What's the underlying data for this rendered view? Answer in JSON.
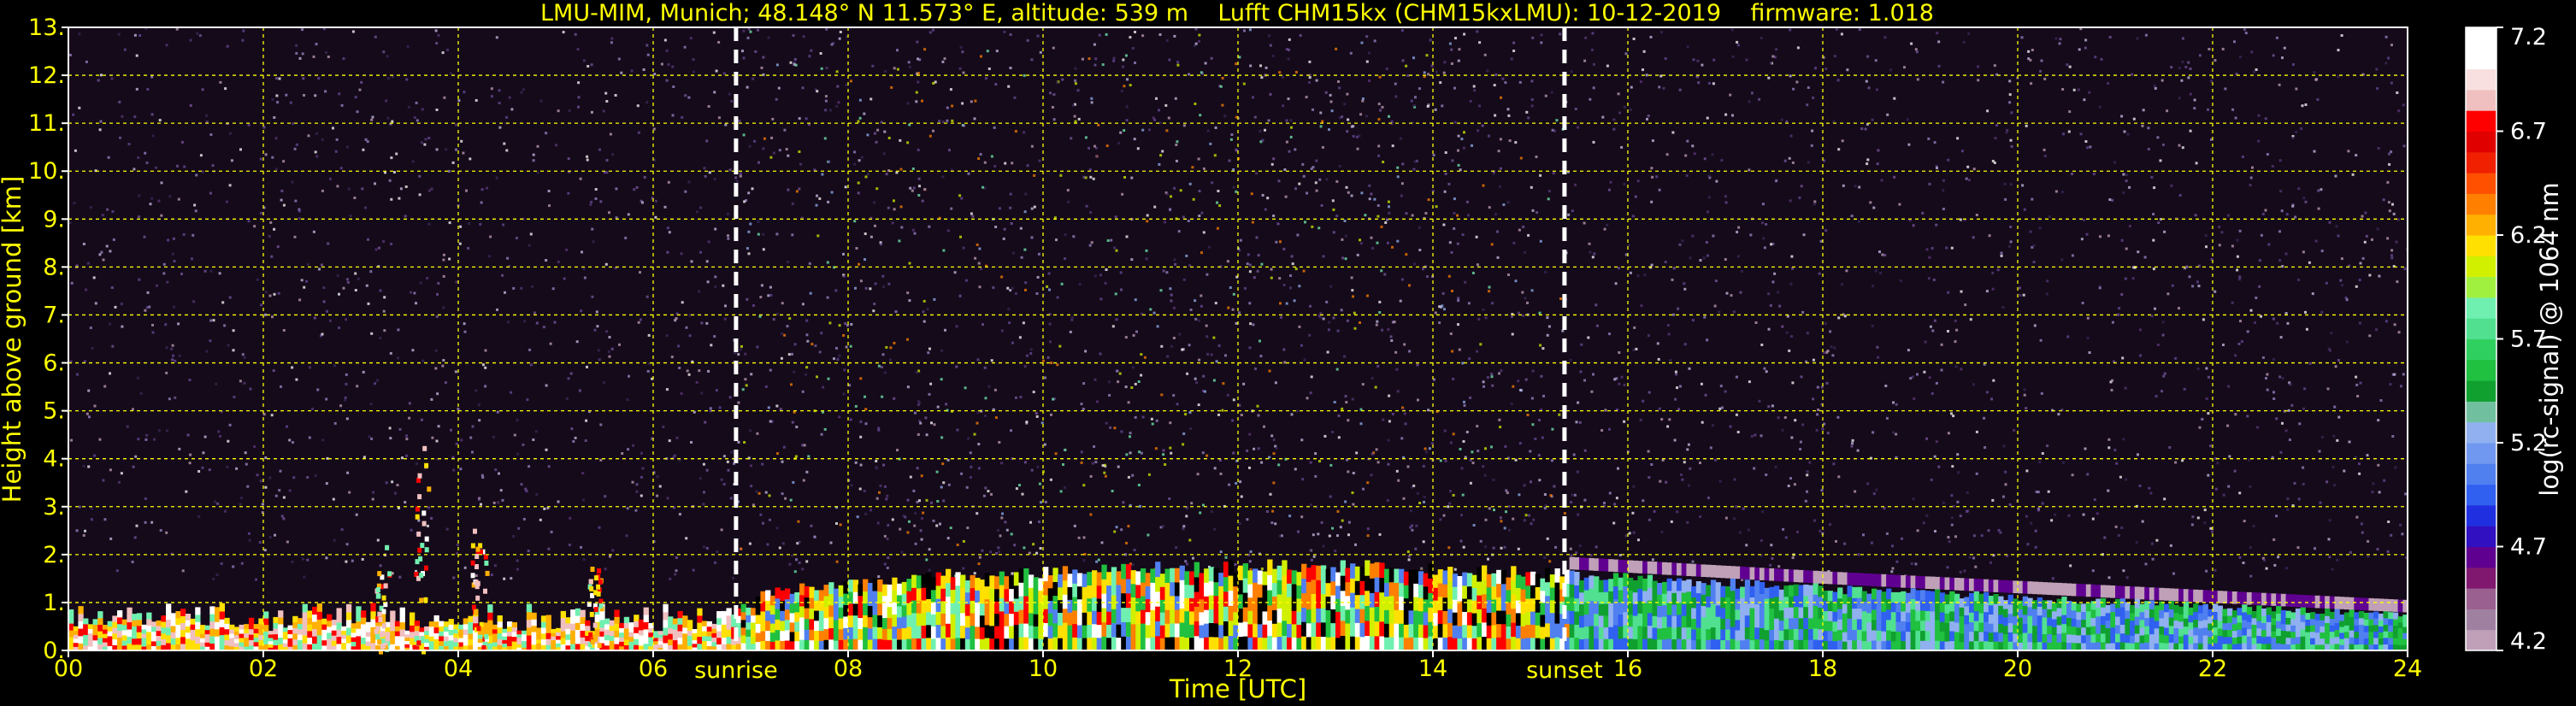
{
  "chart_data": {
    "type": "heatmap",
    "title": "LMU-MIM, Munich; 48.148° N 11.573° E, altitude: 539 m    Lufft CHM15kx (CHM15kxLMU): 10-12-2019    firmware: 1.018",
    "xlabel": "Time [UTC]",
    "ylabel": "Height above ground [km]",
    "xlim": [
      0,
      24
    ],
    "ylim": [
      0,
      13
    ],
    "x_ticks": [
      {
        "value": 0,
        "label": "00"
      },
      {
        "value": 2,
        "label": "02"
      },
      {
        "value": 4,
        "label": "04"
      },
      {
        "value": 6,
        "label": "06"
      },
      {
        "value": 8,
        "label": "08"
      },
      {
        "value": 10,
        "label": "10"
      },
      {
        "value": 12,
        "label": "12"
      },
      {
        "value": 14,
        "label": "14"
      },
      {
        "value": 16,
        "label": "16"
      },
      {
        "value": 18,
        "label": "18"
      },
      {
        "value": 20,
        "label": "20"
      },
      {
        "value": 22,
        "label": "22"
      },
      {
        "value": 24,
        "label": "24"
      }
    ],
    "y_ticks": [
      {
        "value": 0,
        "label": "0."
      },
      {
        "value": 1,
        "label": "1."
      },
      {
        "value": 2,
        "label": "2."
      },
      {
        "value": 3,
        "label": "3."
      },
      {
        "value": 4,
        "label": "4."
      },
      {
        "value": 5,
        "label": "5."
      },
      {
        "value": 6,
        "label": "6."
      },
      {
        "value": 7,
        "label": "7."
      },
      {
        "value": 8,
        "label": "8."
      },
      {
        "value": 9,
        "label": "9."
      },
      {
        "value": 10,
        "label": "10."
      },
      {
        "value": 11,
        "label": "11."
      },
      {
        "value": 12,
        "label": "12."
      },
      {
        "value": 13,
        "label": "13."
      }
    ],
    "grid": true,
    "events": [
      {
        "name": "sunrise",
        "time": 6.85
      },
      {
        "name": "sunset",
        "time": 15.35
      }
    ],
    "colorbar": {
      "label": "log(rc-signal) @ 1064 nm",
      "range": [
        4.2,
        7.2
      ],
      "ticks": [
        4.2,
        4.7,
        5.2,
        5.7,
        6.2,
        6.7,
        7.2
      ],
      "tick_labels": [
        "4.2",
        "4.7",
        "5.2",
        "5.7",
        "6.2",
        "6.7",
        "7.2"
      ],
      "colors": [
        "#c0a0b8",
        "#a080a0",
        "#9a6090",
        "#801870",
        "#600090",
        "#3010c0",
        "#2030e0",
        "#3060f0",
        "#5080f0",
        "#7098f0",
        "#90b0f0",
        "#70c0a0",
        "#10a030",
        "#20c040",
        "#30d060",
        "#50e090",
        "#70f0b0",
        "#a0f040",
        "#d0f000",
        "#ffe000",
        "#ffb000",
        "#ff8000",
        "#ff5000",
        "#f02000",
        "#e00000",
        "#ff0000",
        "#f0c0c0",
        "#f8e0e0",
        "#ffffff",
        "#ffffff"
      ]
    },
    "profile_features": {
      "mixing_layer_top_km": [
        {
          "t": 7.0,
          "h": 1.3
        },
        {
          "t": 9.0,
          "h": 1.7
        },
        {
          "t": 11.7,
          "h": 1.9
        },
        {
          "t": 13.5,
          "h": 1.9
        },
        {
          "t": 15.4,
          "h": 1.7
        },
        {
          "t": 18.0,
          "h": 1.4
        },
        {
          "t": 22.0,
          "h": 1.0
        },
        {
          "t": 24.0,
          "h": 0.8
        }
      ],
      "convective_plumes": [
        {
          "t": 3.6,
          "h": 4.3
        },
        {
          "t": 3.2,
          "h": 2.2
        },
        {
          "t": 4.2,
          "h": 2.6
        },
        {
          "t": 5.4,
          "h": 1.8
        }
      ]
    }
  }
}
